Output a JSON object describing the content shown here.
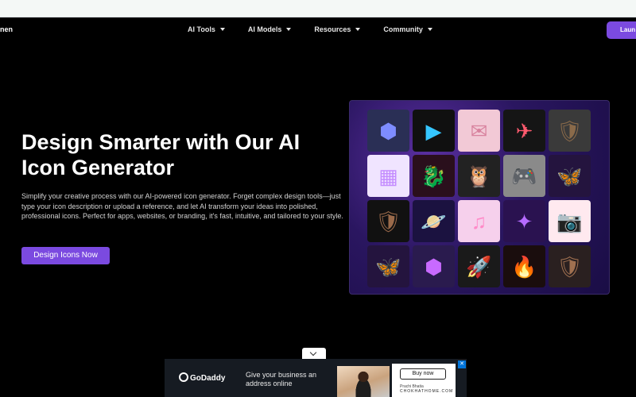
{
  "nav": {
    "brand_fragment": "nen",
    "items": [
      {
        "label": "AI Tools"
      },
      {
        "label": "AI Models"
      },
      {
        "label": "Resources"
      },
      {
        "label": "Community"
      }
    ],
    "launch_label": "Laun"
  },
  "hero": {
    "title": "Design Smarter with Our AI Icon Generator",
    "description": "Simplify your creative process with our AI-powered icon generator. Forget complex design tools—just type your icon description or upload a reference, and let AI transform your ideas into polished, professional icons. Perfect for apps, websites, or branding, it's fast, intuitive, and tailored to your style.",
    "cta_label": "Design Icons Now"
  },
  "icon_grid": [
    {
      "name": "cube-icon",
      "glyph": "⬢",
      "bg": "#2a2f55",
      "color": "#7e8cff"
    },
    {
      "name": "play-button-icon",
      "glyph": "▶",
      "bg": "#101010",
      "color": "#35c6ff"
    },
    {
      "name": "mail-icon",
      "glyph": "✉",
      "bg": "#f2c9d6",
      "color": "#d8829e"
    },
    {
      "name": "airplane-icon",
      "glyph": "✈",
      "bg": "#151515",
      "color": "#ff5a6e"
    },
    {
      "name": "lion-shield-icon",
      "glyph": "🛡",
      "bg": "#3a3a3a",
      "color": "#8a6a4a"
    },
    {
      "name": "app-grid-icon",
      "glyph": "▦",
      "bg": "#f0e4ff",
      "color": "#c48cff"
    },
    {
      "name": "dragon-icon",
      "glyph": "🐉",
      "bg": "#2a0f1c",
      "color": "#d9342b"
    },
    {
      "name": "owl-icon",
      "glyph": "🦉",
      "bg": "#222222",
      "color": "#c8a06a"
    },
    {
      "name": "gamepad-icon",
      "glyph": "🎮",
      "bg": "#8a8a8a",
      "color": "#222222"
    },
    {
      "name": "butterfly-icon",
      "glyph": "🦋",
      "bg": "#24143e",
      "color": "#c874ff"
    },
    {
      "name": "knight-shield-icon",
      "glyph": "🛡",
      "bg": "#111111",
      "color": "#9a6a4a"
    },
    {
      "name": "planet-icon",
      "glyph": "🪐",
      "bg": "#1b1240",
      "color": "#ff6aa8"
    },
    {
      "name": "music-app-icon",
      "glyph": "♫",
      "bg": "#f6d0ec",
      "color": "#ff8ac8"
    },
    {
      "name": "magic-staff-icon",
      "glyph": "✦",
      "bg": "#2a1250",
      "color": "#b66bff"
    },
    {
      "name": "camera-icon",
      "glyph": "📷",
      "bg": "#ffe9ef",
      "color": "#ff8aa8"
    },
    {
      "name": "butterfly-glow-icon",
      "glyph": "🦋",
      "bg": "#24143e",
      "color": "#6ac8ff"
    },
    {
      "name": "neon-cube-icon",
      "glyph": "⬢",
      "bg": "#2a1b4e",
      "color": "#c86aff"
    },
    {
      "name": "rocket-icon",
      "glyph": "🚀",
      "bg": "#1a1a1a",
      "color": "#e84c4c"
    },
    {
      "name": "phoenix-icon",
      "glyph": "🔥",
      "bg": "#1a0d0d",
      "color": "#ff7a2a"
    },
    {
      "name": "crest-shield-icon",
      "glyph": "🛡",
      "bg": "#2a2020",
      "color": "#a07050"
    }
  ],
  "ad": {
    "brand": "GoDaddy",
    "text": "Give your business an address online",
    "buy_label": "Buy now",
    "person_name": "Prachi Bhatia",
    "site": "CHOKHATHOME.COM",
    "close_glyph": "✕"
  }
}
